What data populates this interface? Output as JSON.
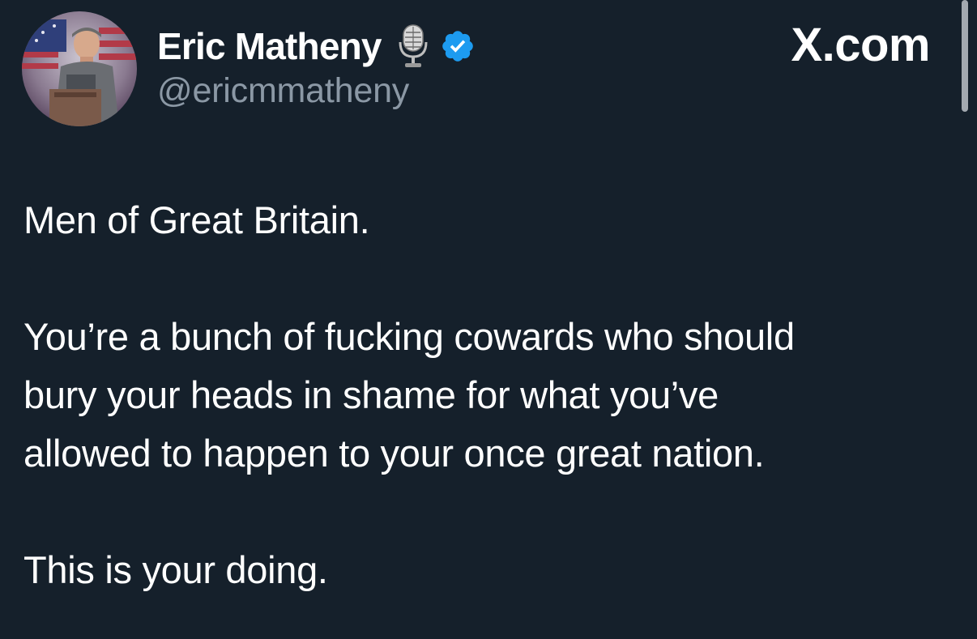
{
  "author": {
    "display_name": "Eric Matheny",
    "handle": "@ericmmatheny",
    "avatar_icon": "profile-photo",
    "badges": [
      "microphone-icon",
      "verified-badge-icon"
    ],
    "verified_color": "#1d9bf0"
  },
  "site_label": "X.com",
  "tweet": {
    "paragraphs": [
      "Men of Great Britain.",
      "You’re a bunch of fucking cowards who should\nbury your heads in shame for what you’ve\nallowed to happen to your once great nation.",
      "This is your doing."
    ]
  },
  "colors": {
    "background": "#15202b",
    "text": "#ffffff",
    "secondary_text": "#8b98a5"
  }
}
